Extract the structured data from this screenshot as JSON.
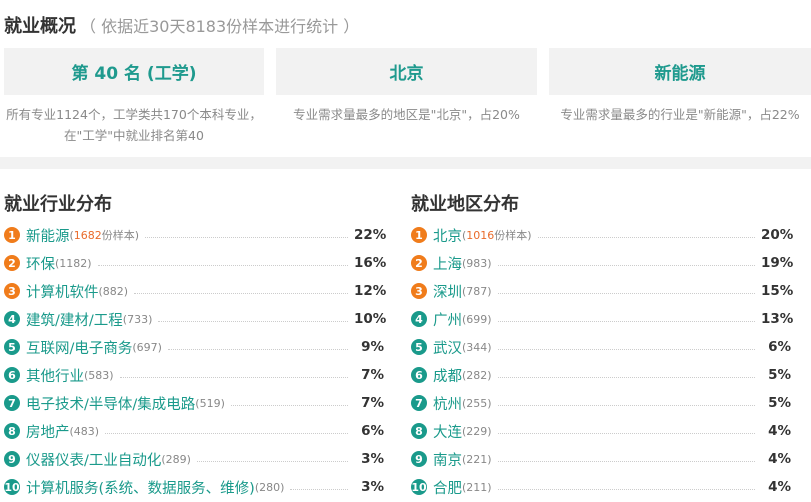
{
  "overview": {
    "title": "就业概况",
    "subtitle": "（ 依据近30天8183份样本进行统计 ）"
  },
  "cards": [
    {
      "label": "第 40 名 (工学)",
      "desc": "所有专业1124个，工学类共170个本科专业，在\"工学\"中就业排名第40"
    },
    {
      "label": "北京",
      "desc": "专业需求量最多的地区是\"北京\"，占20%"
    },
    {
      "label": "新能源",
      "desc": "专业需求量最多的行业是\"新能源\"，占22%"
    }
  ],
  "industry": {
    "title": "就业行业分布",
    "items": [
      {
        "rank": "1",
        "name": "新能源",
        "count": "1682",
        "suffix": "份样本",
        "pct": "22%"
      },
      {
        "rank": "2",
        "name": "环保",
        "count": "(1182)",
        "pct": "16%"
      },
      {
        "rank": "3",
        "name": "计算机软件",
        "count": "(882)",
        "pct": "12%"
      },
      {
        "rank": "4",
        "name": "建筑/建材/工程",
        "count": "(733)",
        "pct": "10%"
      },
      {
        "rank": "5",
        "name": "互联网/电子商务",
        "count": "(697)",
        "pct": "9%"
      },
      {
        "rank": "6",
        "name": "其他行业",
        "count": "(583)",
        "pct": "7%"
      },
      {
        "rank": "7",
        "name": "电子技术/半导体/集成电路",
        "count": "(519)",
        "pct": "7%"
      },
      {
        "rank": "8",
        "name": "房地产",
        "count": "(483)",
        "pct": "6%"
      },
      {
        "rank": "9",
        "name": "仪器仪表/工业自动化",
        "count": "(289)",
        "pct": "3%"
      },
      {
        "rank": "10",
        "name": "计算机服务(系统、数据服务、维修)",
        "count": "(280)",
        "pct": "3%"
      }
    ]
  },
  "region": {
    "title": "就业地区分布",
    "items": [
      {
        "rank": "1",
        "name": "北京",
        "count": "1016",
        "suffix": "份样本",
        "pct": "20%"
      },
      {
        "rank": "2",
        "name": "上海",
        "count": "(983)",
        "pct": "19%"
      },
      {
        "rank": "3",
        "name": "深圳",
        "count": "(787)",
        "pct": "15%"
      },
      {
        "rank": "4",
        "name": "广州",
        "count": "(699)",
        "pct": "13%"
      },
      {
        "rank": "5",
        "name": "武汉",
        "count": "(344)",
        "pct": "6%"
      },
      {
        "rank": "6",
        "name": "成都",
        "count": "(282)",
        "pct": "5%"
      },
      {
        "rank": "7",
        "name": "杭州",
        "count": "(255)",
        "pct": "5%"
      },
      {
        "rank": "8",
        "name": "大连",
        "count": "(229)",
        "pct": "4%"
      },
      {
        "rank": "9",
        "name": "南京",
        "count": "(221)",
        "pct": "4%"
      },
      {
        "rank": "10",
        "name": "合肥",
        "count": "(211)",
        "pct": "4%"
      }
    ]
  },
  "colors": {
    "accent": "#1a9a8b",
    "top_rank": "#f07c1b",
    "highlight_count": "#e96b2b"
  }
}
